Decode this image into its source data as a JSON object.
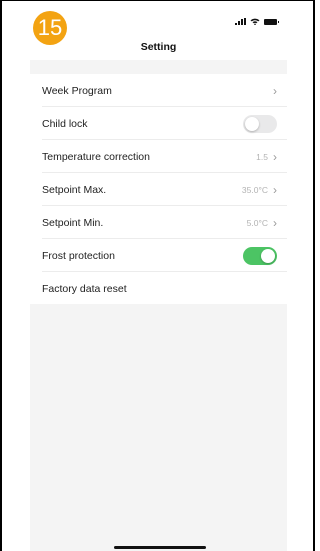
{
  "step_number": "15",
  "header": {
    "title": "Setting"
  },
  "settings": [
    {
      "label": "Week Program",
      "value": "",
      "control": "chevron"
    },
    {
      "label": "Child lock",
      "value": "",
      "control": "toggle",
      "on": false
    },
    {
      "label": "Temperature correction",
      "value": "1.5",
      "control": "chevron"
    },
    {
      "label": "Setpoint Max.",
      "value": "35.0°C",
      "control": "chevron"
    },
    {
      "label": "Setpoint Min.",
      "value": "5.0°C",
      "control": "chevron"
    },
    {
      "label": "Frost protection",
      "value": "",
      "control": "toggle",
      "on": true
    },
    {
      "label": "Factory data reset",
      "value": "",
      "control": "none"
    }
  ],
  "icons": {
    "chevron": "chevron-right-icon",
    "signal": "signal-icon",
    "wifi": "wifi-icon",
    "battery": "battery-icon"
  },
  "colors": {
    "toggle_on": "#4cc464",
    "toggle_off": "#e9e9ea",
    "badge": "#f3a312"
  }
}
